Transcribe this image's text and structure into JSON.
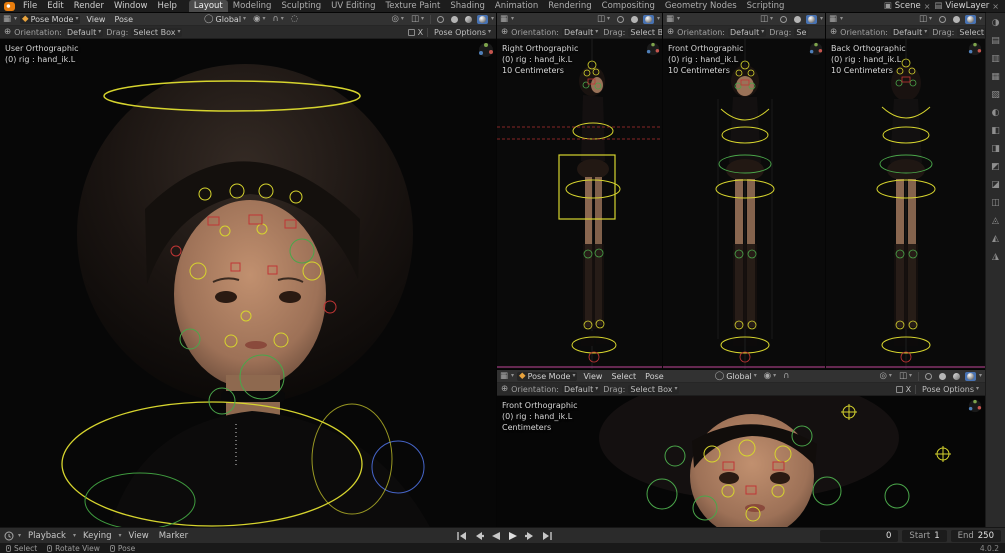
{
  "topbar": {
    "menus": [
      "File",
      "Edit",
      "Render",
      "Window",
      "Help"
    ],
    "workspaces": [
      "Layout",
      "Modeling",
      "Sculpting",
      "UV Editing",
      "Texture Paint",
      "Shading",
      "Animation",
      "Rendering",
      "Compositing",
      "Geometry Nodes",
      "Scripting"
    ],
    "active_workspace": "Layout",
    "scene_name": "Scene",
    "viewlayer_name": "ViewLayer"
  },
  "icons": {
    "chevron": "▾",
    "editor_3d": "▦",
    "armature": "◆",
    "globe": "◯",
    "pivot": "◉",
    "magnet": "∩",
    "proportional": "◌",
    "gizmo_toggle": "◎",
    "overlay_toggle": "◫",
    "orientation_tool": "⊕",
    "close": "×",
    "scene": "▣",
    "viewlayer": "▤"
  },
  "colors": {
    "accent": "#4772b3",
    "rig_yellow": "#d6d42e",
    "rig_green": "#4aa64a",
    "rig_red": "#c03535",
    "rig_blue": "#4665c9",
    "line_magenta": "#9c3a7c"
  },
  "viewports": {
    "main": {
      "mode": "Pose Mode",
      "menu_view": "View",
      "menu_pose": "Pose",
      "orientation": "Global",
      "tools": {
        "orientation_label": "Orientation:",
        "orientation_value": "Default",
        "drag_label": "Drag:",
        "drag_value": "Select Box",
        "mirror_x": "X",
        "options": "Pose Options"
      },
      "overlay": {
        "line1": "User Orthographic",
        "line2": "(0) rig : hand_ik.L"
      }
    },
    "side": {
      "tools": {
        "orientation_label": "Orientation:",
        "orientation_value": "Default",
        "drag_label": "Drag:",
        "drag_value": "Select B"
      },
      "overlay": {
        "line1": "Right Orthographic",
        "line2": "(0) rig : hand_ik.L",
        "line3": "10 Centimeters"
      }
    },
    "front": {
      "tools": {
        "orientation_label": "Orientation:",
        "orientation_value": "Default",
        "drag_label": "Drag:",
        "drag_value": "Se"
      },
      "overlay": {
        "line1": "Front Orthographic",
        "line2": "(0) rig : hand_ik.L",
        "line3": "10 Centimeters"
      }
    },
    "back": {
      "tools": {
        "orientation_label": "Orientation:",
        "orientation_value": "Default",
        "drag_label": "Drag:",
        "drag_value": "Select Box"
      },
      "overlay": {
        "line1": "Back Orthographic",
        "line2": "(0) rig : hand_ik.L",
        "line3": "10 Centimeters"
      }
    },
    "face": {
      "mode": "Pose Mode",
      "menu_view": "View",
      "menu_select": "Select",
      "menu_pose": "Pose",
      "orientation": "Global",
      "tools": {
        "orientation_label": "Orientation:",
        "orientation_value": "Default",
        "drag_label": "Drag:",
        "drag_value": "Select Box",
        "mirror_x": "X",
        "options": "Pose Options"
      },
      "overlay": {
        "line1": "Front Orthographic",
        "line2": "(0) rig : hand_ik.L",
        "line3": "Centimeters"
      }
    }
  },
  "properties_tabs": {
    "glyphs": [
      "◑",
      "▤",
      "▥",
      "▦",
      "▧",
      "◐",
      "◧",
      "◨",
      "◩",
      "◪",
      "◫",
      "◬",
      "◭",
      "◮"
    ]
  },
  "timeline": {
    "menus": [
      "Playback",
      "Keying",
      "View",
      "Marker"
    ],
    "frame_current": "0",
    "start_label": "Start",
    "start_value": "1",
    "end_label": "End",
    "end_value": "250"
  },
  "statusbar": {
    "hints": [
      "Select",
      "Rotate View",
      "Pose"
    ],
    "version": "4.0.2"
  }
}
